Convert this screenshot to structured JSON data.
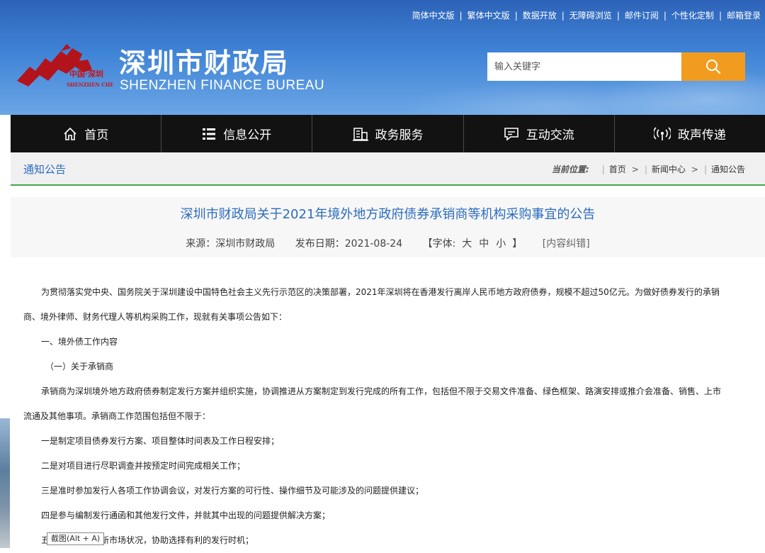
{
  "toplinks": [
    "简体中文版",
    "繁体中文版",
    "数据开放",
    "无障碍浏览",
    "邮件订阅",
    "个性化定制",
    "邮箱登录"
  ],
  "logo": {
    "name_cn": "深圳市财政局",
    "name_en": "SHENZHEN FINANCE BUREAU",
    "emblem_cn": "中国·深圳",
    "emblem_en": "SHENZHEN CHINA"
  },
  "search": {
    "placeholder": "输入关键字"
  },
  "nav": [
    {
      "label": "首页",
      "icon": "home-icon"
    },
    {
      "label": "信息公开",
      "icon": "list-icon"
    },
    {
      "label": "政务服务",
      "icon": "building-icon"
    },
    {
      "label": "互动交流",
      "icon": "chat-icon"
    },
    {
      "label": "政声传递",
      "icon": "broadcast-icon"
    }
  ],
  "section": {
    "title": "通知公告"
  },
  "breadcrumb": {
    "label": "当前位置:",
    "items": [
      "首页",
      "新闻中心",
      "通知公告"
    ]
  },
  "article": {
    "title": "深圳市财政局关于2021年境外地方政府债券承销商等机构采购事宜的公告",
    "source": "来源：深圳市财政局",
    "date": "发布日期：2021-08-24",
    "font_label": "【字体:",
    "font_sizes": [
      "大",
      "中",
      "小"
    ],
    "font_close": "】",
    "correction": "[内容纠错]"
  },
  "body": {
    "p1": "为贯彻落实党中央、国务院关于深圳建设中国特色社会主义先行示范区的决策部署，2021年深圳将在香港发行离岸人民币地方政府债券，规模不超过50亿元。为做好债券发行的承销",
    "p1b": "商、境外律师、财务代理人等机构采购工作，现就有关事项公告如下：",
    "h1": "一、境外债工作内容",
    "h2": "（一）关于承销商",
    "p2": "承销商为深圳境外地方政府债券制定发行方案并组织实施，协调推进从方案制定到发行完成的所有工作，包括但不限于交易文件准备、绿色框架、路演安排或推介会准备、销售、上市",
    "p2b": "流通及其他事项。承销商工作范围包括但不限于：",
    "i1": "一是制定项目债券发行方案、项目整体时间表及工作日程安排；",
    "i2": "二是对项目进行尽职调查并按预定时间完成相关工作；",
    "i3": "三是准时参加发行人各项工作协调会议，对发行方案的可行性、操作细节及可能涉及的问题提供建议；",
    "i4": "四是参与编制发行通函和其他发行文件，并就其中出现的问题提供解决方案；",
    "i5": "五是向发行人更新市场状况，协助选择有利的发行时机；"
  },
  "tooltip": "截图(Alt + A)",
  "colors": {
    "accent_orange": "#f29c1f",
    "link_blue": "#2b6cbf",
    "nav_bg": "#121212",
    "green_rule": "#46a84a"
  }
}
